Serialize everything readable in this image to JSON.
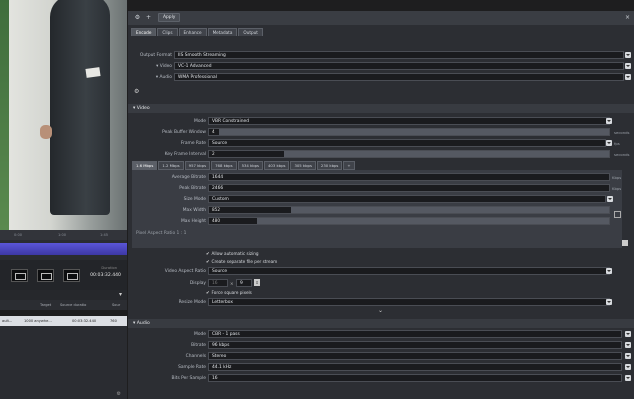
{
  "topbar": {
    "apply_label": "Apply"
  },
  "tabs": [
    "Encode",
    "Clips",
    "Enhance",
    "Metadata",
    "Output"
  ],
  "encode": {
    "output_format_label": "Output Format",
    "output_format_value": "IIS Smooth Streaming",
    "video_label": "Video",
    "video_value": "VC-1 Advanced",
    "audio_label": "Audio",
    "audio_value": "WMA Professional"
  },
  "video_section": {
    "title": "Video",
    "mode_label": "Mode",
    "mode_value": "VBR Constrained",
    "peak_buffer_label": "Peak Buffer Window",
    "peak_buffer_value": "4",
    "peak_buffer_unit": "seconds",
    "frame_rate_label": "Frame Rate",
    "frame_rate_value": "Source",
    "frame_rate_unit": "fps",
    "key_frame_label": "Key Frame Interval",
    "key_frame_value": "2",
    "key_frame_unit": "seconds",
    "bitrate_tabs": [
      "1.6 Mbps",
      "1.2 Mbps",
      "957 kbps",
      "768 kbps",
      "534 kbps",
      "403 kbps",
      "305 kbps",
      "230 kbps",
      "+"
    ],
    "avg_bitrate_label": "Average Bitrate",
    "avg_bitrate_value": "1644",
    "avg_bitrate_unit": "Kbps",
    "peak_bitrate_label": "Peak Bitrate",
    "peak_bitrate_value": "2466",
    "peak_bitrate_unit": "Kbps",
    "size_mode_label": "Size Mode",
    "size_mode_value": "Custom",
    "max_width_label": "Max Width",
    "max_width_value": "852",
    "max_height_label": "Max Height",
    "max_height_value": "480",
    "pixel_aspect_label": "Pixel Aspect Ratio",
    "pixel_aspect_value": "1 : 1",
    "allow_auto_sizing": "Allow automatic sizing",
    "separate_file": "Create separate file per stream",
    "video_aspect_label": "Video Aspect Ratio",
    "video_aspect_value": "Source",
    "display_label": "Display",
    "display_w": "16",
    "display_h": "9",
    "force_square": "Force square pixels",
    "resize_mode_label": "Resize Mode",
    "resize_mode_value": "Letterbox"
  },
  "audio_section": {
    "title": "Audio",
    "mode_label": "Mode",
    "mode_value": "CBR - 1 pass",
    "bitrate_label": "Bitrate",
    "bitrate_value": "96 kbps",
    "channels_label": "Channels",
    "channels_value": "Stereo",
    "sample_rate_label": "Sample Rate",
    "sample_rate_value": "44.1 kHz",
    "bits_label": "Bits Per Sample",
    "bits_value": "16"
  },
  "left": {
    "timecode": "00:03:32.440",
    "timecode_label": "Duration",
    "ruler_marks": [
      "0:00",
      "1:00",
      "1:45"
    ],
    "table_headers": [
      "Target",
      "Source duratio",
      "Sour"
    ],
    "table_row": [
      "ault...",
      "1000 anywhe...",
      "00:03:32.440",
      "760"
    ]
  },
  "colors": {
    "accent_purple": "#4a45c4",
    "panel_bg": "#2c2e33"
  }
}
